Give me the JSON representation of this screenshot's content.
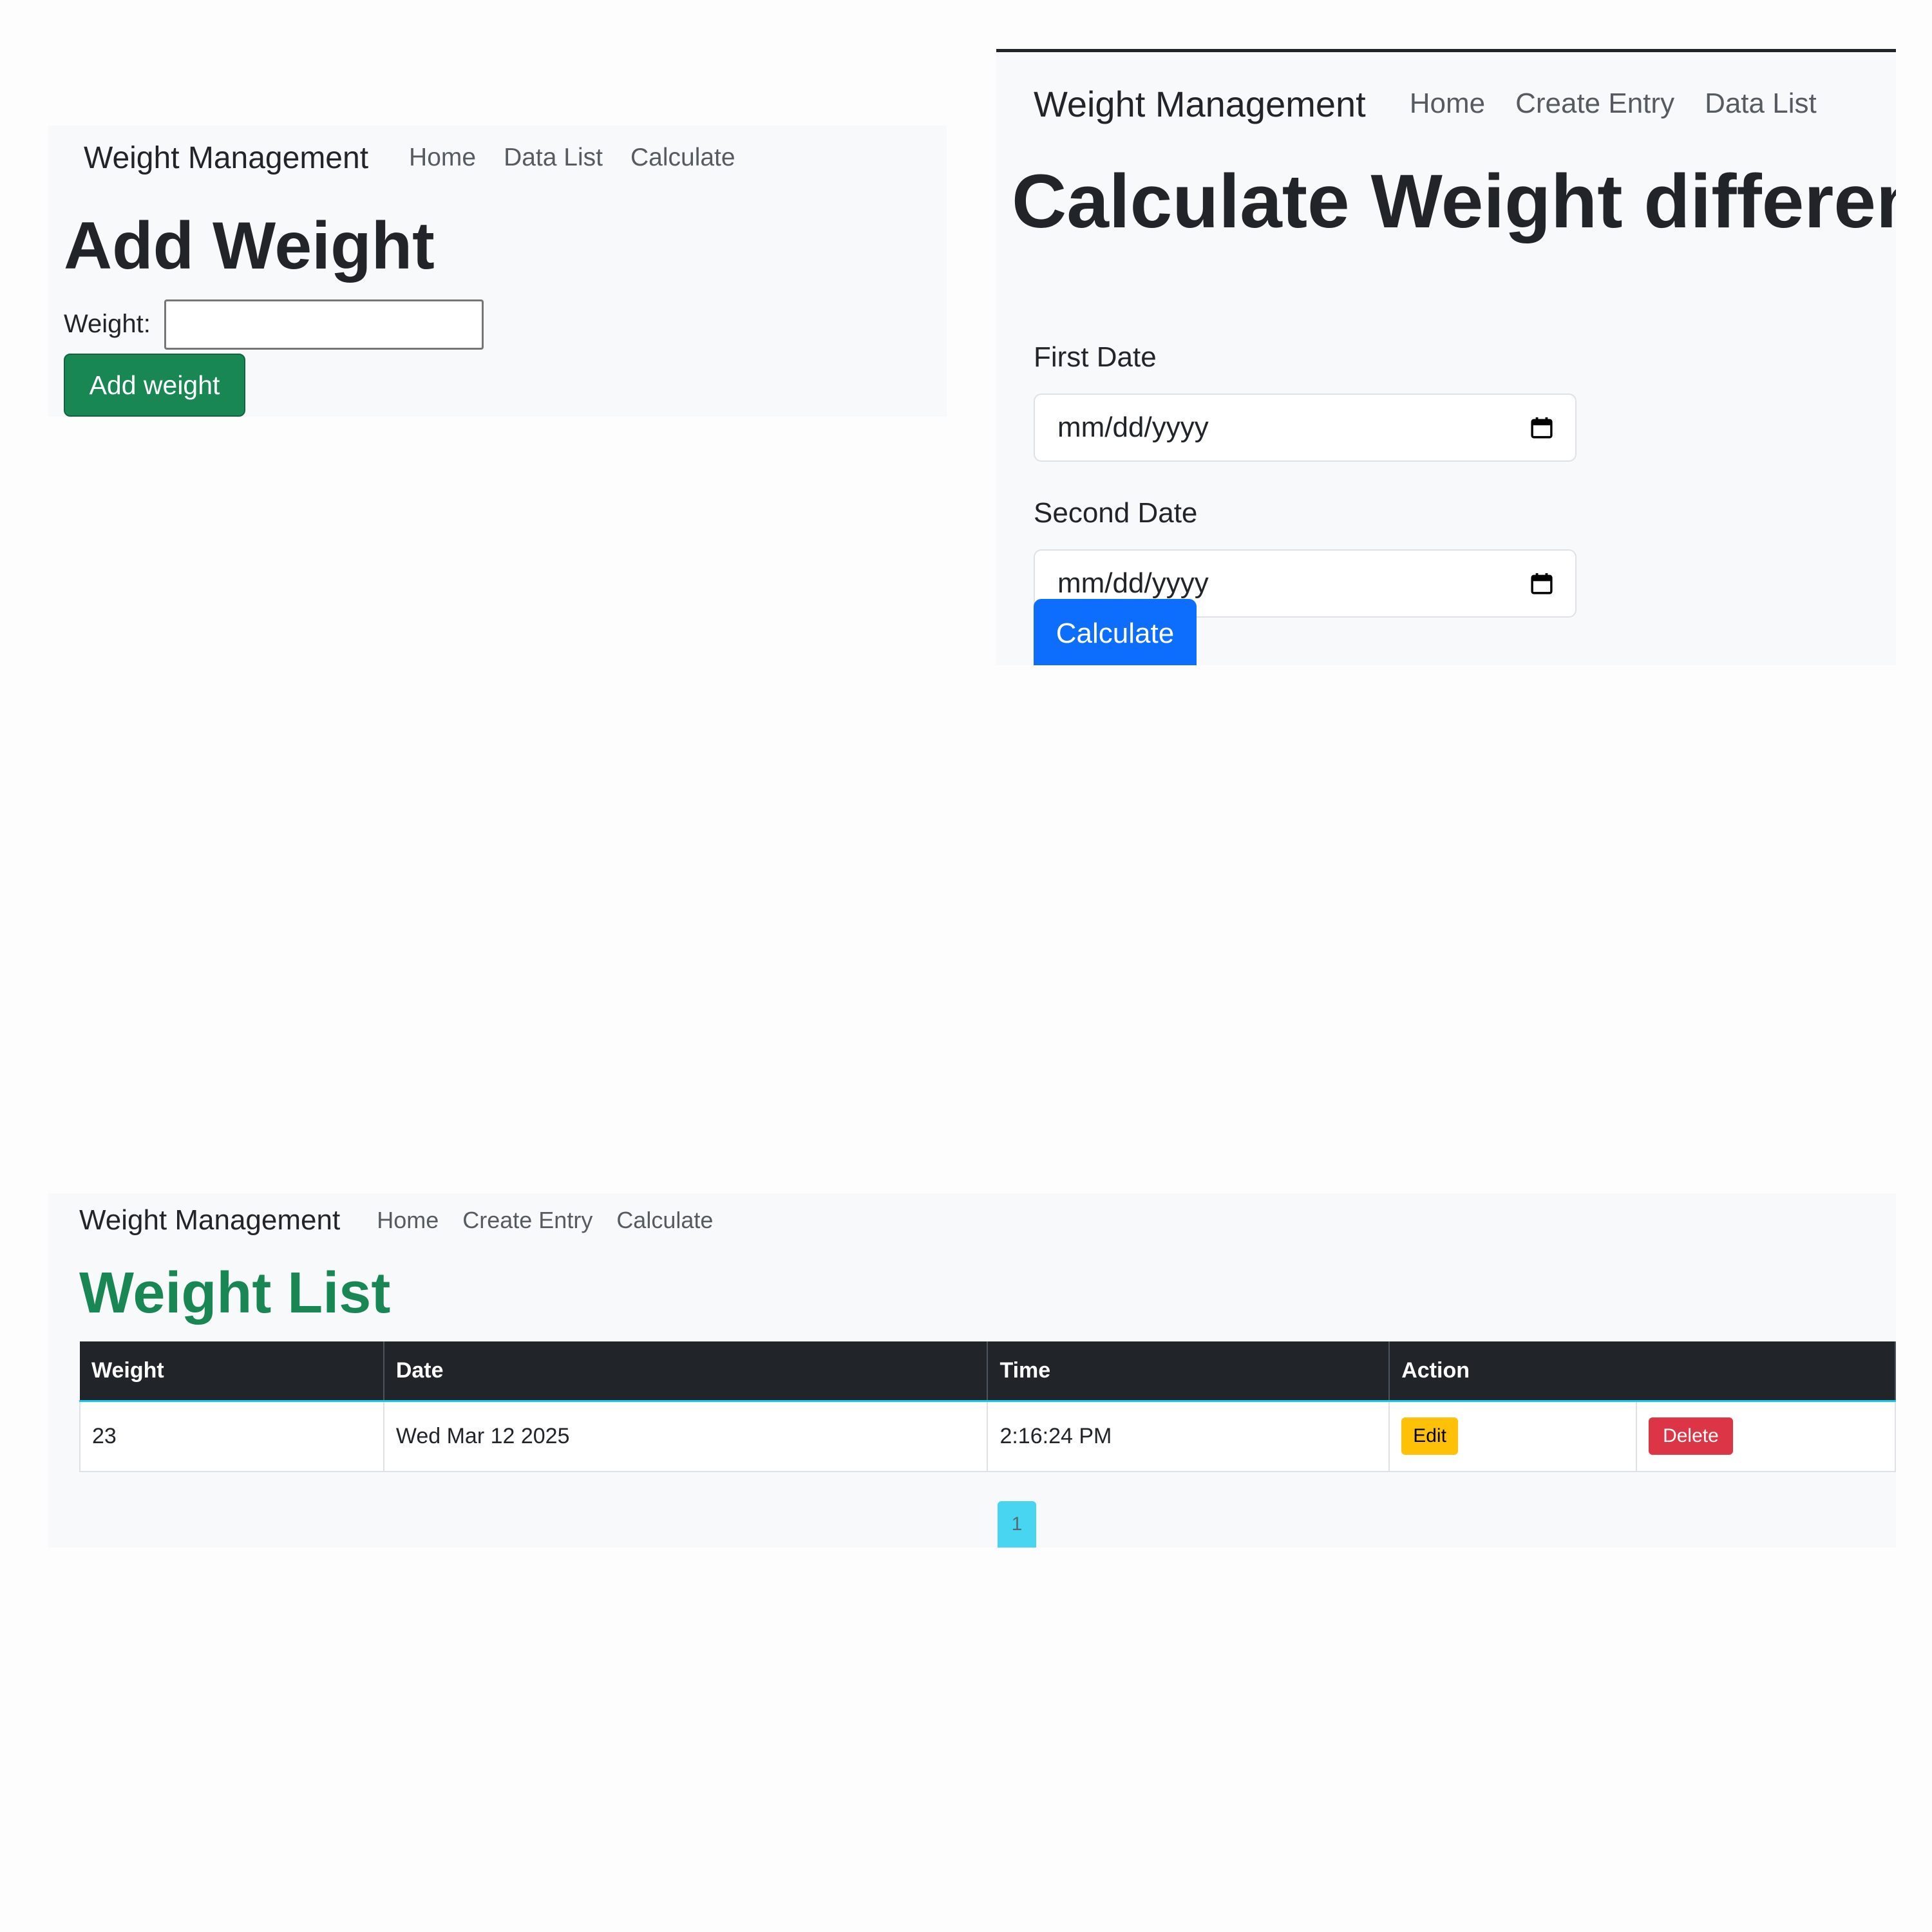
{
  "add_page": {
    "brand": "Weight Management",
    "nav": [
      {
        "label": "Home"
      },
      {
        "label": "Data List"
      },
      {
        "label": "Calculate"
      }
    ],
    "title": "Add Weight",
    "weight_label": "Weight:",
    "weight_value": "",
    "submit_label": "Add weight"
  },
  "calc_page": {
    "brand": "Weight Management",
    "nav": [
      {
        "label": "Home"
      },
      {
        "label": "Create Entry"
      },
      {
        "label": "Data List"
      }
    ],
    "title": "Calculate Weight difference",
    "first_date_label": "First Date",
    "first_date_placeholder": "mm/dd/yyyy",
    "second_date_label": "Second Date",
    "second_date_placeholder": "mm/dd/yyyy",
    "submit_label": "Calculate"
  },
  "list_page": {
    "brand": "Weight Management",
    "nav": [
      {
        "label": "Home"
      },
      {
        "label": "Create Entry"
      },
      {
        "label": "Calculate"
      }
    ],
    "title": "Weight List",
    "columns": [
      "Weight",
      "Date",
      "Time",
      "Action"
    ],
    "rows": [
      {
        "weight": "23",
        "date": "Wed Mar 12 2025",
        "time": "2:16:24 PM",
        "edit_label": "Edit",
        "delete_label": "Delete"
      }
    ],
    "pagination": {
      "current_page": "1"
    }
  }
}
